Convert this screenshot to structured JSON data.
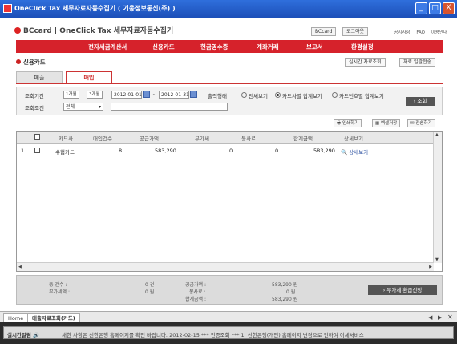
{
  "window": {
    "title": "OneClick Tax 세무자료자동수집기 ( 기웅정보통신(주) )",
    "controls": [
      "_",
      "□",
      "X"
    ]
  },
  "header": {
    "logo": "BCcard | OneClick Tax 세무자료자동수집기",
    "user_button": "BCcard",
    "logout_button": "로그아웃",
    "links": [
      "공지사항",
      "FAQ",
      "이용안내"
    ]
  },
  "menu": [
    "전자세금계산서",
    "신용카드",
    "현금영수증",
    "계좌거래",
    "보고서",
    "환경설정"
  ],
  "section_title": "신용카드",
  "top_buttons": {
    "realtime": "실시간 자료조회",
    "batch": "자료 일괄전송"
  },
  "tabs": [
    {
      "label": "매출",
      "active": false
    },
    {
      "label": "매입",
      "active": true
    }
  ],
  "filter": {
    "period_label": "조회기간",
    "period_1m": "1개월",
    "period_3m": "3개월",
    "date_from": "2012-01-01",
    "date_sep": "~",
    "date_to": "2012-01-31",
    "output_label": "출력형태",
    "options": [
      {
        "label": "전체보기",
        "selected": false
      },
      {
        "label": "카드사별 합계보기",
        "selected": true
      },
      {
        "label": "카드번호별 합계보기",
        "selected": false
      }
    ],
    "condition_label": "조회조건",
    "condition_value": "전체",
    "search_button": "조회"
  },
  "actions": {
    "print": "인쇄하기",
    "excel": "엑셀저장",
    "send": "전송하기"
  },
  "table": {
    "columns": [
      "",
      "카드사",
      "매입건수",
      "공급가액",
      "부가세",
      "봉사료",
      "합계금액",
      "상세보기"
    ],
    "rows": [
      {
        "no": "1",
        "card_company": "수협카드",
        "count": "8",
        "supply": "583,290",
        "vat": "0",
        "service": "0",
        "total": "583,290",
        "detail": "상세보기"
      }
    ]
  },
  "summary": {
    "total_count_label": "총 건수 :",
    "total_count_value": "0 건",
    "vat_free_label": "부가세액 :",
    "vat_free_value": "0 원",
    "supply_label": "공급가액 :",
    "supply_value": "583,290 원",
    "service_label": "봉사료 :",
    "service_value": "0 원",
    "total_label": "합계금액 :",
    "total_value": "583,290 원",
    "refund_button": "부가세 환급신청"
  },
  "bottom_tabs": {
    "home": "Home",
    "current": "매출자료조회(카드)"
  },
  "ticker": {
    "label": "실시간알림",
    "text": "새한 사항은 신한은행      홈페이지를 확인 바랍니다.      2012-02-15   *** 인증조회 ***    1. 신한은행(개인)     홈페이지 변경으로 인하여     이체서비스"
  }
}
